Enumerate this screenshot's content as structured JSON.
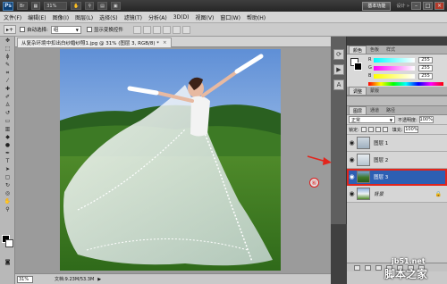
{
  "titlebar": {
    "logo": "Ps",
    "zoom": "31%",
    "workspace_active": "基本功能",
    "workspace_link": "设计 »",
    "min": "–",
    "max": "□",
    "close": "×"
  },
  "menu": [
    "文件(F)",
    "编辑(E)",
    "图像(I)",
    "图层(L)",
    "选择(S)",
    "滤镜(T)",
    "分析(A)",
    "3D(D)",
    "视图(V)",
    "窗口(W)",
    "帮助(H)"
  ],
  "options": {
    "tool_icon": "▸+",
    "auto_select_label": "自动选择:",
    "auto_select_value": "组",
    "show_transform_label": "显示变换控件"
  },
  "document": {
    "tab_title": "从复杂环境中扣出白纱婚纱照1.jpg @ 31% (图层 3, RGB/8) *",
    "tab_close": "×",
    "zoom": "31%",
    "info": "文档:9.23M/53.3M",
    "arrow": "▶"
  },
  "color_panel": {
    "tabs": [
      "颜色",
      "色板",
      "样式"
    ],
    "rows": [
      {
        "channel": "R",
        "value": "255"
      },
      {
        "channel": "G",
        "value": "255"
      },
      {
        "channel": "B",
        "value": "255"
      }
    ]
  },
  "adjust_panel": {
    "tabs": [
      "调整",
      "蒙版"
    ]
  },
  "layers_panel": {
    "tabs": [
      "图层",
      "通道",
      "路径"
    ],
    "blend_mode": "正常",
    "opacity_label": "不透明度:",
    "opacity_value": "100%",
    "lock_label": "锁定:",
    "fill_label": "填充:",
    "fill_value": "100%",
    "layers": [
      {
        "name": "图层 1",
        "visible": true,
        "selected": false
      },
      {
        "name": "图层 2",
        "visible": true,
        "selected": false
      },
      {
        "name": "图层 3",
        "visible": true,
        "selected": true
      },
      {
        "name": "背景",
        "visible": true,
        "selected": false,
        "locked": true
      }
    ]
  },
  "annotation": {
    "step": "⑥"
  },
  "watermark": {
    "url": "jb51.net",
    "site": "脚本之家"
  },
  "colors": {
    "selected_layer": "#2d5fb3",
    "highlight": "#e2251c"
  }
}
